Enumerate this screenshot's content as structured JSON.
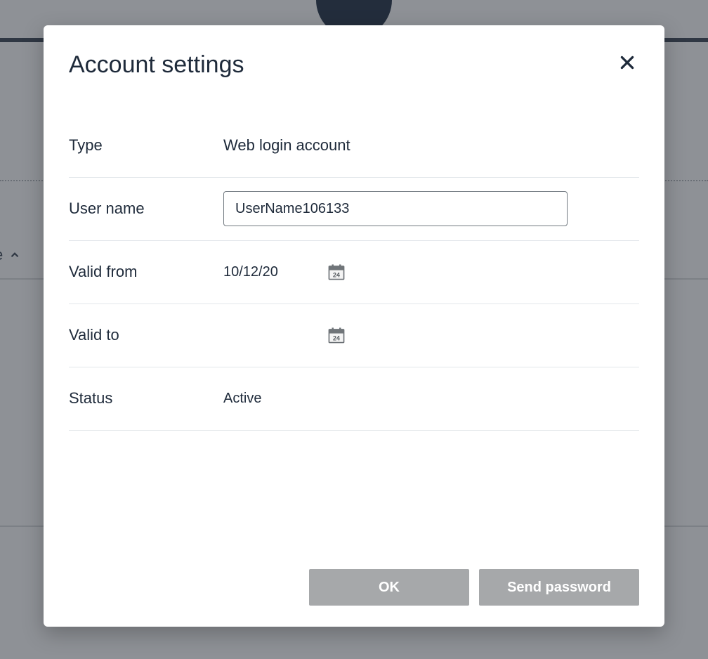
{
  "modal": {
    "title": "Account settings",
    "fields": {
      "type": {
        "label": "Type",
        "value": "Web login account"
      },
      "username": {
        "label": "User name",
        "value": "UserName106133"
      },
      "valid_from": {
        "label": "Valid from",
        "value": "10/12/20"
      },
      "valid_to": {
        "label": "Valid to",
        "value": ""
      },
      "status": {
        "label": "Status",
        "value": "Active"
      }
    },
    "buttons": {
      "ok": "OK",
      "send_password": "Send password"
    }
  },
  "background": {
    "truncated_label": "e"
  }
}
